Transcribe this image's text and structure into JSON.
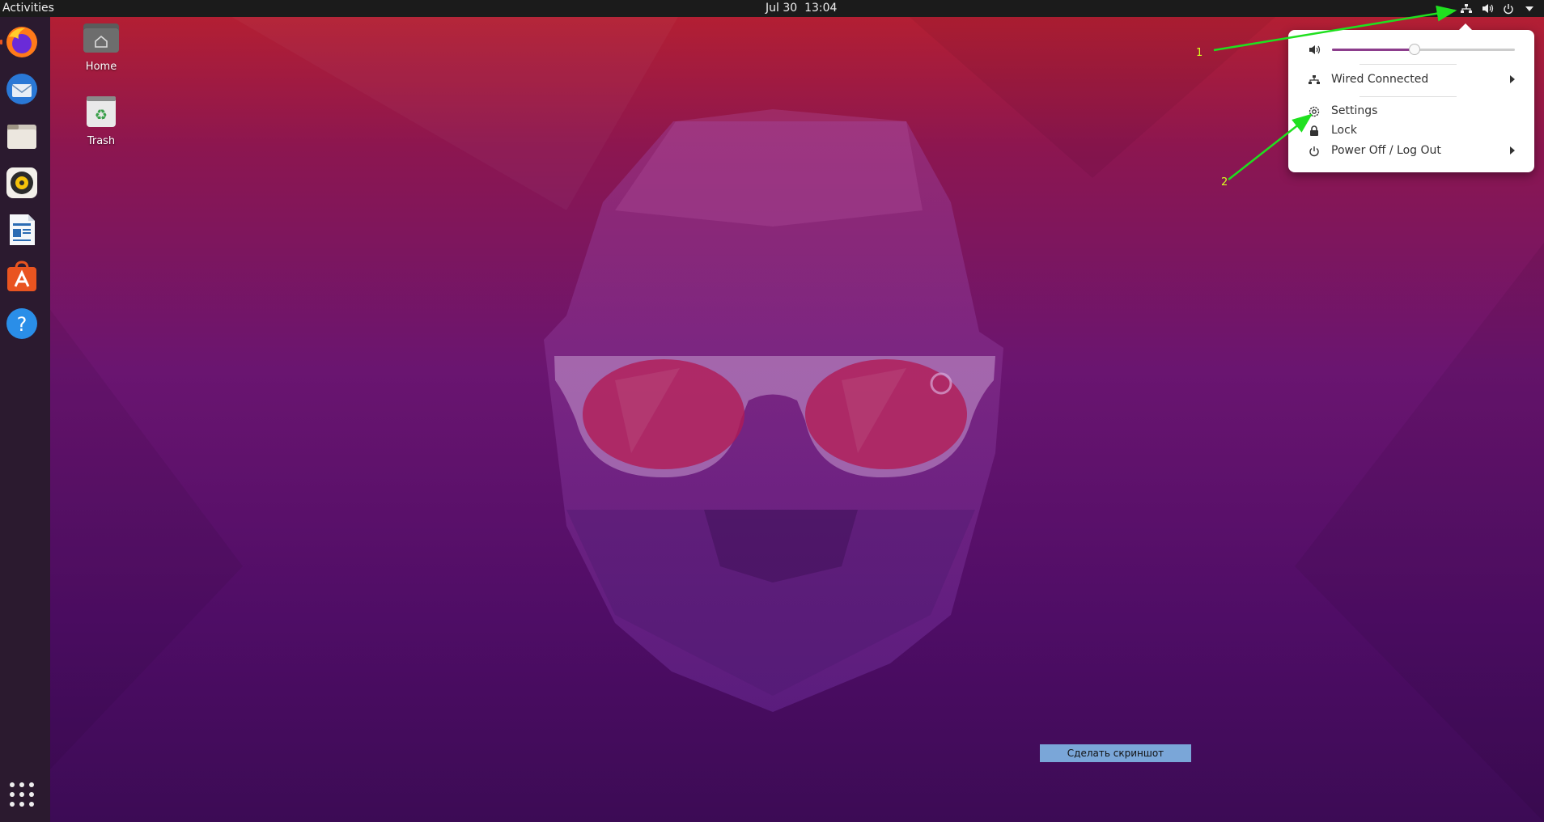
{
  "topbar": {
    "activities": "Activities",
    "date": "Jul 30",
    "time": "13:04",
    "tray_icons": [
      "network-icon",
      "volume-icon",
      "power-icon",
      "dropdown-arrow-icon"
    ]
  },
  "dock": {
    "apps": [
      "firefox",
      "thunderbird",
      "files",
      "rhythmbox",
      "libreoffice-writer",
      "ubuntu-software",
      "help"
    ]
  },
  "desktop": {
    "home_label": "Home",
    "trash_label": "Trash"
  },
  "system_menu": {
    "volume_percent": 45,
    "wired_label": "Wired Connected",
    "settings_label": "Settings",
    "lock_label": "Lock",
    "power_label": "Power Off / Log Out"
  },
  "annotations": {
    "label_1": "1",
    "label_2": "2",
    "color": "#1fe01f"
  },
  "screenshot_button": "Сделать скриншот",
  "colors": {
    "accent": "#e95420",
    "slider": "#8c3d8c",
    "topbar": "#1b1b1b",
    "dock": "#2b1a2f"
  }
}
